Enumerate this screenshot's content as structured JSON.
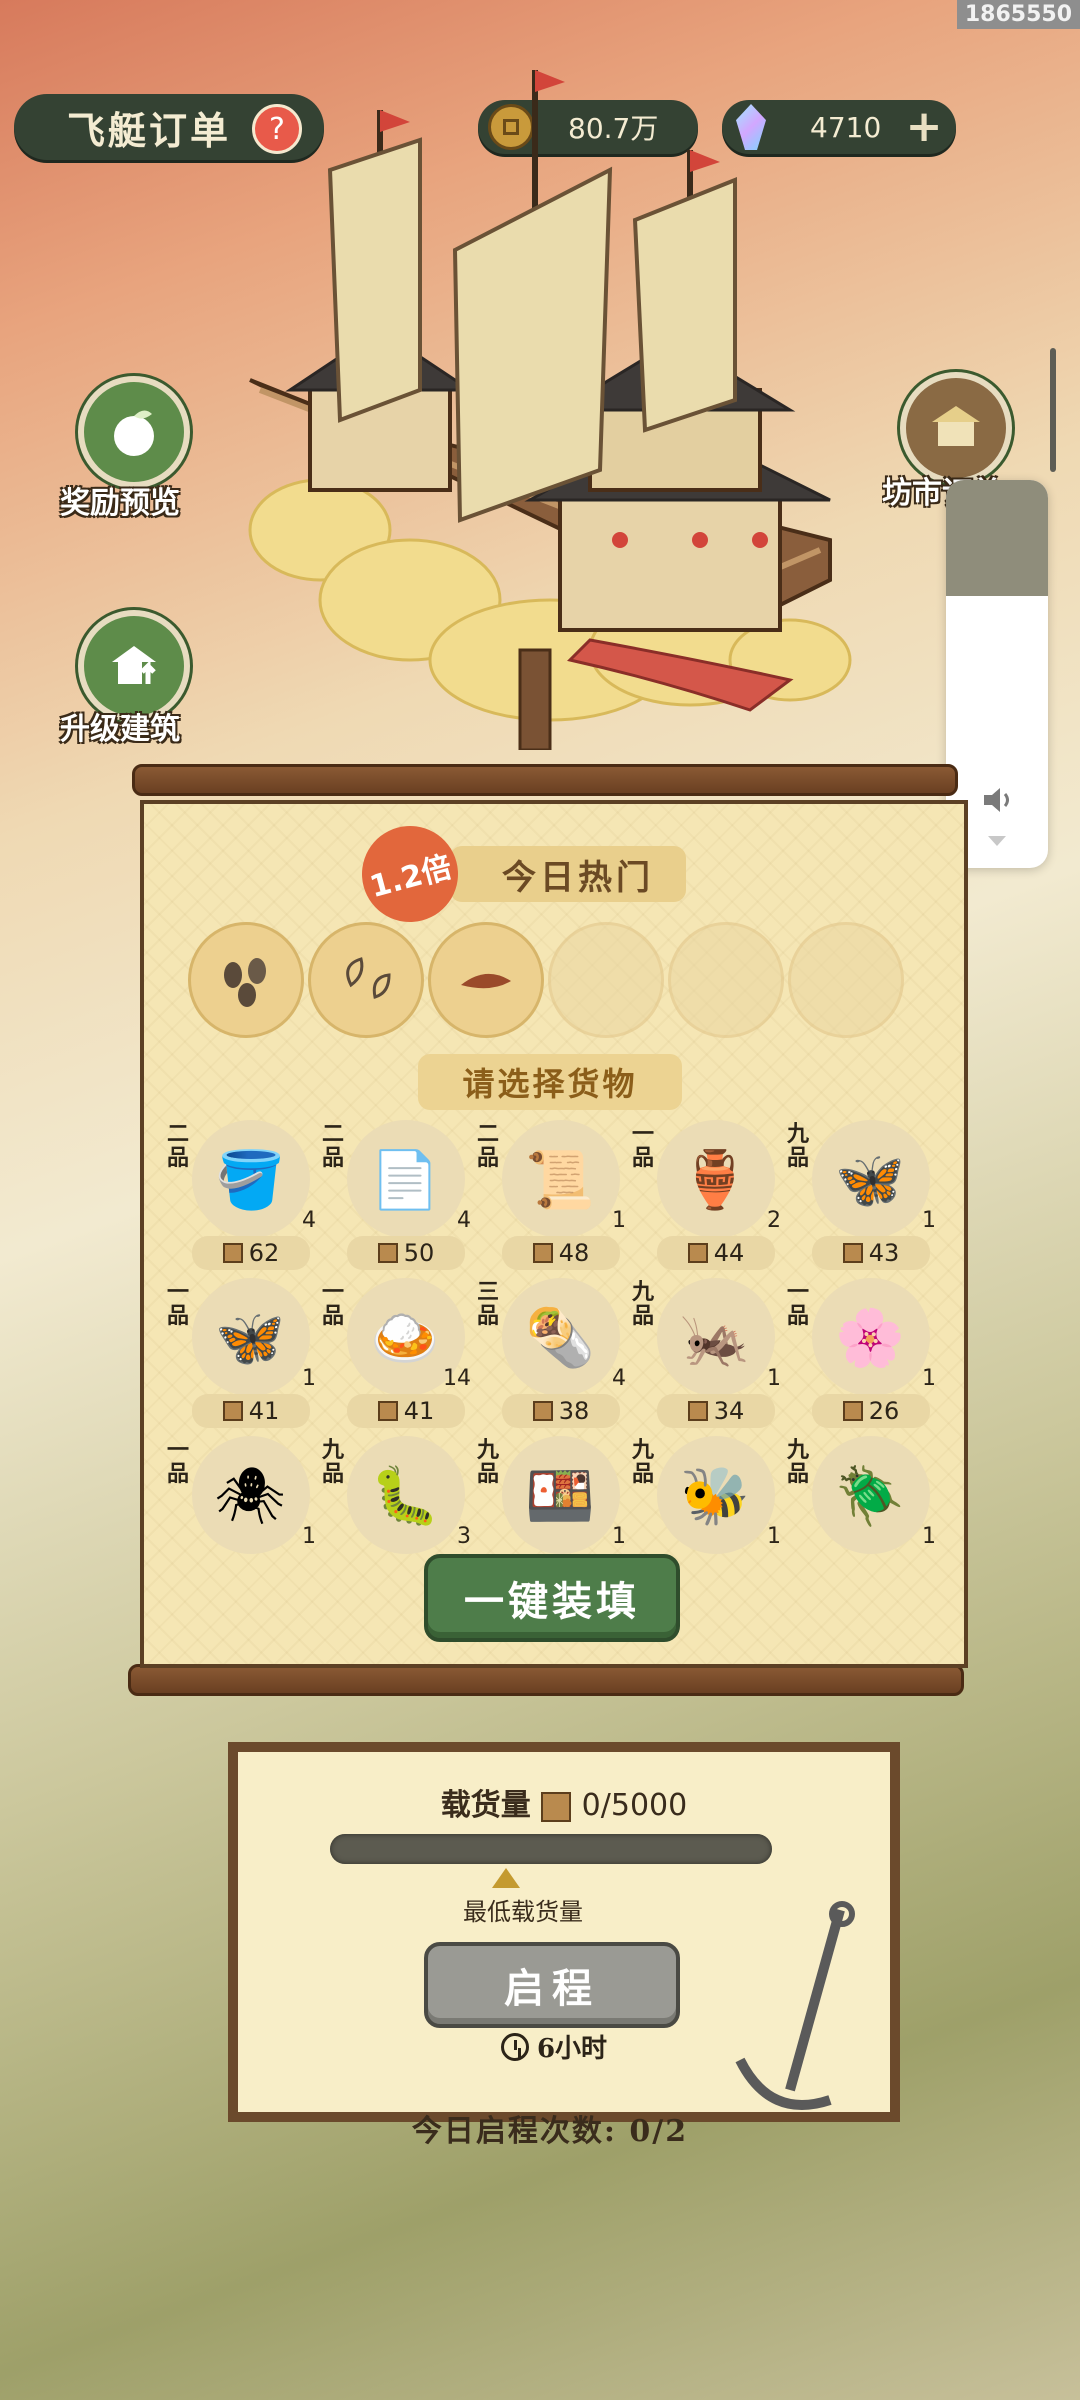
{
  "header": {
    "title": "飞艇订单",
    "help_symbol": "?",
    "coins": "80.7万",
    "gems": "4710",
    "plus_symbol": "+",
    "watermark": "1865550"
  },
  "side_buttons": {
    "reward_preview": "奖励预览",
    "upgrade_building": "升级建筑",
    "market": "坊市订单"
  },
  "hot_section": {
    "multiplier": "1.2倍",
    "title": "今日热门"
  },
  "goods_section": {
    "title": "请选择货物",
    "items": [
      {
        "grade": "二品",
        "icon": "🪣",
        "qty": "4",
        "count": "62"
      },
      {
        "grade": "二品",
        "icon": "📄",
        "qty": "4",
        "count": "50"
      },
      {
        "grade": "二品",
        "icon": "📜",
        "qty": "1",
        "count": "48"
      },
      {
        "grade": "一品",
        "icon": "🏺",
        "qty": "2",
        "count": "44"
      },
      {
        "grade": "九品",
        "icon": "🦋",
        "qty": "1",
        "count": "43"
      },
      {
        "grade": "一品",
        "icon": "🦋",
        "qty": "1",
        "count": "41"
      },
      {
        "grade": "一品",
        "icon": "🍛",
        "qty": "14",
        "count": "41"
      },
      {
        "grade": "三品",
        "icon": "🌯",
        "qty": "4",
        "count": "38"
      },
      {
        "grade": "九品",
        "icon": "🦗",
        "qty": "1",
        "count": "34"
      },
      {
        "grade": "一品",
        "icon": "🌸",
        "qty": "1",
        "count": "26"
      },
      {
        "grade": "一品",
        "icon": "🕷",
        "qty": "1",
        "count": ""
      },
      {
        "grade": "九品",
        "icon": "🐛",
        "qty": "3",
        "count": ""
      },
      {
        "grade": "九品",
        "icon": "🍱",
        "qty": "1",
        "count": ""
      },
      {
        "grade": "九品",
        "icon": "🐝",
        "qty": "1",
        "count": ""
      },
      {
        "grade": "九品",
        "icon": "🪲",
        "qty": "1",
        "count": ""
      }
    ],
    "load_all_button": "一键装填"
  },
  "cargo": {
    "label": "载货量",
    "value": "0/5000",
    "fill_fraction": 0,
    "min_label": "最低载货量",
    "start_button": "启程",
    "duration": "6小时",
    "departures_today": "今日启程次数: 0/2"
  },
  "volume": {
    "level_fraction": 0.7
  },
  "colors": {
    "header_dark": "#344233",
    "button_green": "#4e7d4a",
    "button_disabled": "#9a9a94",
    "scroll_paper": "#f5e6b4"
  }
}
